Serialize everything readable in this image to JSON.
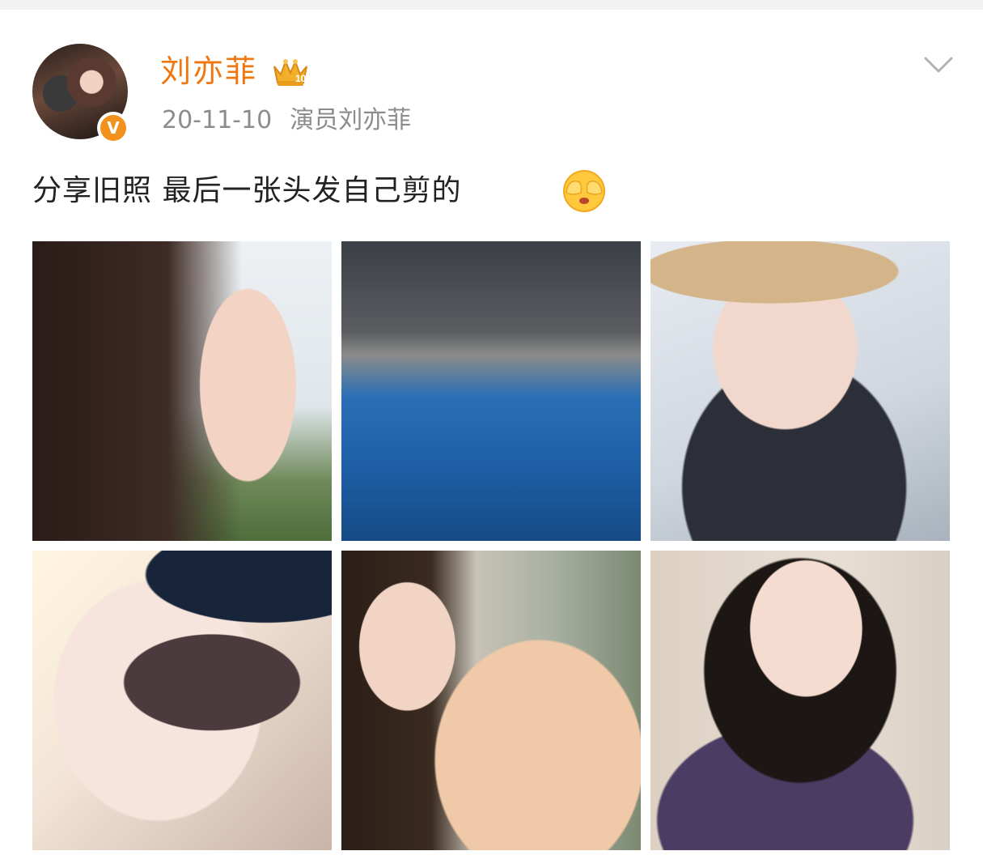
{
  "post": {
    "username": "刘亦菲",
    "member_badge": "10",
    "verified_badge": "V",
    "date": "20-11-10",
    "source": "演员刘亦菲",
    "text": "分享旧照 最后一张头发自己剪的",
    "emoji": "shy-cover-face-emoji"
  },
  "photos": [
    {
      "name": "photo-1"
    },
    {
      "name": "photo-2"
    },
    {
      "name": "photo-3"
    },
    {
      "name": "photo-4"
    },
    {
      "name": "photo-5"
    },
    {
      "name": "photo-6"
    }
  ],
  "colors": {
    "username": "#f0770f",
    "meta": "#8c8c8c",
    "text": "#222222",
    "verified": "#f2911b"
  },
  "icons": {
    "more": "chevron-down-icon",
    "member": "crown-icon"
  }
}
